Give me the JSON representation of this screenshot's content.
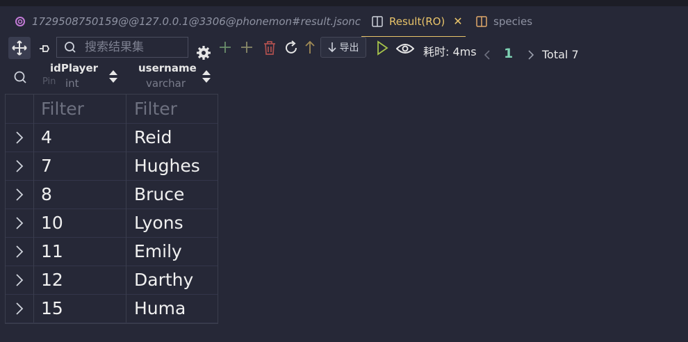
{
  "tabs": [
    {
      "label": "1729508750159@@127.0.0.1@3306@phonemon#result.jsonc",
      "icon": "connection-icon",
      "active": false
    },
    {
      "label": "Result(RO)",
      "icon": "split-view-icon",
      "active": true,
      "close": "✕"
    },
    {
      "label": "species",
      "icon": "split-view-icon",
      "active": false
    }
  ],
  "toolbar": {
    "search_placeholder": "搜索结果集",
    "export_label": "导出",
    "elapsed_label": "耗时: 4ms",
    "page": "1",
    "total_label": "Total 7"
  },
  "columns": [
    {
      "name": "idPlayer",
      "type": "int"
    },
    {
      "name": "username",
      "type": "varchar"
    }
  ],
  "pin_label": "Pin",
  "filter_placeholder": "Filter",
  "rows": [
    {
      "id": "4",
      "username": "Reid"
    },
    {
      "id": "7",
      "username": "Hughes"
    },
    {
      "id": "8",
      "username": "Bruce"
    },
    {
      "id": "10",
      "username": "Lyons"
    },
    {
      "id": "11",
      "username": "Emily"
    },
    {
      "id": "12",
      "username": "Darthy"
    },
    {
      "id": "15",
      "username": "Huma"
    }
  ],
  "colors": {
    "background": "#262837",
    "accent": "#e9c46a",
    "page_number": "#7fd3b4",
    "add_icon": "#6b8e6b",
    "delete_icon": "#b0504f"
  }
}
